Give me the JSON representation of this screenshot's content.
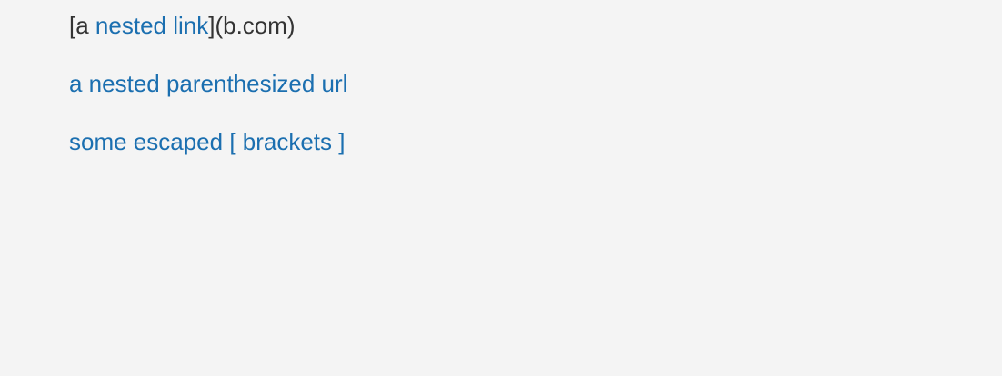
{
  "lines": {
    "nested_link": {
      "prefix": "[a ",
      "link_text": "nested link",
      "suffix": "](b.com)"
    },
    "parenthesized_url": {
      "link_text": "a nested parenthesized url"
    },
    "escaped_brackets": {
      "link_text": "some escaped [ brackets ]"
    }
  },
  "colors": {
    "background": "#f4f4f4",
    "text": "#333333",
    "link": "#1b6fb0"
  }
}
